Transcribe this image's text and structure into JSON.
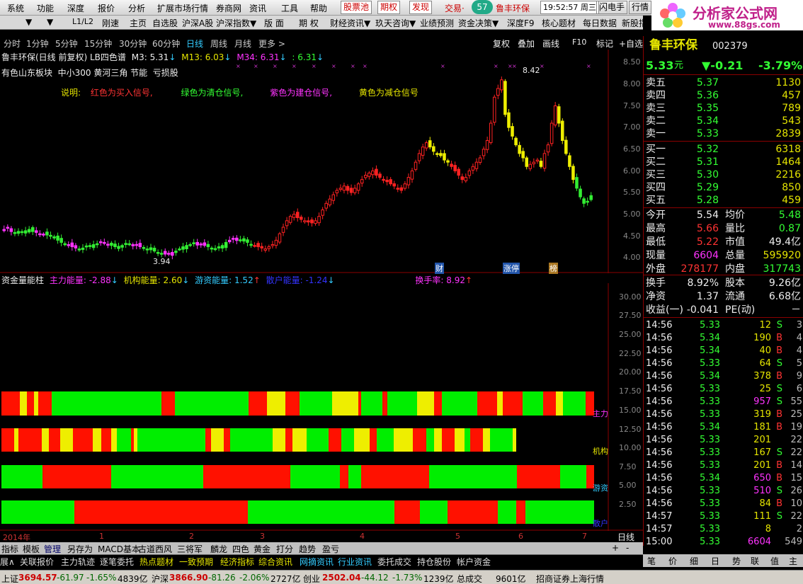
{
  "menu": [
    "系统",
    "功能",
    "深度",
    "报价",
    "分析",
    "扩展市场行情",
    "券商网",
    "资讯",
    "工具",
    "帮助",
    "股票池",
    "期权",
    "发现",
    "交易·",
    "57",
    "鲁丰环保"
  ],
  "clock": "19:52:57 周三",
  "menu_right": [
    "闪电手",
    "行情"
  ],
  "logo": {
    "title": "分析家公式网",
    "url": "www.88gs.com"
  },
  "toolbar": [
    "▼",
    "▼",
    "L1/L2",
    "刚速",
    "主页",
    "自选股",
    "沪深A股",
    "沪深指数▼",
    "版 面",
    "期 权",
    "财经资讯▼",
    "玖天咨询▼",
    "业绩预测",
    "资金决策▼",
    "深度F9",
    "核心题材",
    "每日数据",
    "新股指南"
  ],
  "periods": [
    "分时",
    "1分钟",
    "5分钟",
    "15分钟",
    "30分钟",
    "60分钟",
    "日线",
    "周线",
    "月线",
    "更多 >"
  ],
  "chart_tools": [
    "复权",
    "叠加",
    "画线",
    "F10",
    "标记",
    "+自选"
  ],
  "legend": {
    "title": "鲁丰环保(日线 前复权) LB四色谱",
    "m3": "M3: 5.31",
    "m13": "M13: 6.03",
    "m34": "M34: 6.31",
    "m4": ": 6.31"
  },
  "concepts": "有色山东板块  中小300 黄河三角 节能  亏损股",
  "explain": {
    "lead": "说明:",
    "red": "红色为买入信号,",
    "green": "绿色为清仓信号,",
    "purple": "紫色为建仓信号,",
    "yellow": "黄色为减仓信号"
  },
  "price_axis": [
    "8.50",
    "8.00",
    "7.50",
    "7.00",
    "6.50",
    "6.00",
    "5.50",
    "5.00",
    "4.50",
    "4.00"
  ],
  "annotations": {
    "high": "8.42",
    "low": "3.94",
    "badge1": "财",
    "badge2": "涨停",
    "badge3": "榜"
  },
  "energy": {
    "title": "资金量能柱",
    "main": "主力能量: -2.88",
    "inst": "机构能量: 2.60",
    "hot": "游资能量: 1.52",
    "retail": "散户能量: -1.24",
    "turnover": "换手率: 8.92"
  },
  "energy_axis": [
    "30.00",
    "27.50",
    "25.00",
    "22.50",
    "20.00",
    "17.50",
    "15.00",
    "12.50",
    "10.00",
    "7.50",
    "5.00",
    "2.50"
  ],
  "band_labels": [
    "主力",
    "机构",
    "游资",
    "散户"
  ],
  "time_axis": [
    "2014年",
    "1",
    "2",
    "3",
    "4",
    "5",
    "6",
    "7",
    "8"
  ],
  "daily_label": "日线",
  "quote": {
    "name": "鲁丰环保",
    "code": "002379",
    "price": "5.33",
    "unit": "元",
    "change": "▼-0.21",
    "pct": "-3.79%",
    "asks": [
      [
        "卖五",
        "5.37",
        "1130"
      ],
      [
        "卖四",
        "5.36",
        "457"
      ],
      [
        "卖三",
        "5.35",
        "789"
      ],
      [
        "卖二",
        "5.34",
        "543"
      ],
      [
        "卖一",
        "5.33",
        "2839"
      ]
    ],
    "bids": [
      [
        "买一",
        "5.32",
        "6318"
      ],
      [
        "买二",
        "5.31",
        "1464"
      ],
      [
        "买三",
        "5.30",
        "2216"
      ],
      [
        "买四",
        "5.29",
        "850"
      ],
      [
        "买五",
        "5.28",
        "459"
      ]
    ],
    "stats": [
      [
        "今开",
        "5.54",
        "均价",
        "5.48"
      ],
      [
        "最高",
        "5.66",
        "量比",
        "0.87"
      ],
      [
        "最低",
        "5.22",
        "市值",
        "49.4亿"
      ],
      [
        "现量",
        "6604",
        "总量",
        "595920"
      ],
      [
        "外盘",
        "278177",
        "内盘",
        "317743"
      ]
    ],
    "fund": [
      [
        "换手",
        "8.92%",
        "股本",
        "9.26亿"
      ],
      [
        "净资",
        "1.37",
        "流通",
        "6.68亿"
      ],
      [
        "收益(一)",
        "-0.041",
        "PE(动)",
        "－"
      ]
    ]
  },
  "ticks": [
    [
      "14:56",
      "5.33",
      "12",
      "S",
      "3"
    ],
    [
      "14:56",
      "5.34",
      "190",
      "B",
      "4"
    ],
    [
      "14:56",
      "5.34",
      "40",
      "B",
      "4"
    ],
    [
      "14:56",
      "5.33",
      "64",
      "S",
      "5"
    ],
    [
      "14:56",
      "5.34",
      "378",
      "B",
      "9"
    ],
    [
      "14:56",
      "5.33",
      "25",
      "S",
      "6"
    ],
    [
      "14:56",
      "5.33",
      "957",
      "S",
      "55"
    ],
    [
      "14:56",
      "5.33",
      "319",
      "B",
      "25"
    ],
    [
      "14:56",
      "5.34",
      "181",
      "B",
      "19"
    ],
    [
      "14:56",
      "5.33",
      "201",
      "",
      "22"
    ],
    [
      "14:56",
      "5.33",
      "167",
      "S",
      "22"
    ],
    [
      "14:56",
      "5.33",
      "201",
      "B",
      "14"
    ],
    [
      "14:56",
      "5.34",
      "650",
      "B",
      "15"
    ],
    [
      "14:56",
      "5.33",
      "510",
      "S",
      "26"
    ],
    [
      "14:56",
      "5.33",
      "84",
      "B",
      "10"
    ],
    [
      "14:57",
      "5.33",
      "111",
      "S",
      "22"
    ],
    [
      "14:57",
      "5.33",
      "8",
      "",
      "2"
    ],
    [
      "15:00",
      "5.33",
      "6604",
      "",
      "549"
    ]
  ],
  "bottom_tabs": [
    "指标",
    "模板",
    "管理",
    "另存为",
    "MACD基本",
    "古道西风",
    "三将军",
    "麟龙",
    "四色",
    "黄金",
    "打分",
    "趋势",
    "盈亏"
  ],
  "bottom_right": [
    "+",
    "-"
  ],
  "info_tabs": [
    "展∧",
    "关联报价",
    "主力轨迹",
    "逐笔委托",
    "热点题材",
    "一致预期",
    "经济指标",
    "综合资讯",
    "网摘资讯",
    "行业资讯",
    "委托成交",
    "持仓股份",
    "帐户资金"
  ],
  "right_tabs": [
    "侧边栏<",
    "笔",
    "价",
    "细",
    "日",
    "势",
    "联",
    "值",
    "主"
  ],
  "status": {
    "sh_label": "上证",
    "sh_val": "3694.57",
    "sh_chg": "-61.97",
    "sh_pct": "-1.65%",
    "sh_amt": "4839亿",
    "sz_label": "沪深",
    "sz_val": "3866.90",
    "sz_chg": "-81.26",
    "sz_pct": "-2.06%",
    "sz_amt": "2727亿",
    "cy_label": "创业",
    "cy_val": "2502.04",
    "cy_chg": "-44.12",
    "cy_pct": "-1.73%",
    "cy_amt": "1239亿",
    "total_label": "总成交",
    "total_val": "9601亿",
    "broker": "招商证券上海行情"
  },
  "chart_data": {
    "type": "candlestick",
    "y_range": [
      3.8,
      8.6
    ],
    "closes": [
      4.55,
      4.58,
      4.5,
      4.48,
      4.46,
      4.5,
      4.52,
      4.55,
      4.5,
      4.48,
      4.45,
      4.44,
      4.42,
      4.4,
      4.38,
      4.3,
      4.25,
      4.22,
      4.2,
      4.15,
      4.12,
      4.1,
      4.12,
      4.15,
      4.18,
      4.2,
      4.22,
      4.25,
      4.25,
      4.2,
      4.18,
      4.15,
      4.16,
      4.18,
      4.2,
      4.22,
      4.2,
      4.18,
      4.15,
      4.12,
      4.1,
      4.08,
      4.05,
      4.02,
      4.0,
      3.98,
      4.0,
      4.02,
      4.05,
      4.1,
      4.15,
      4.18,
      4.2,
      4.22,
      4.25,
      4.2,
      4.18,
      4.15,
      4.12,
      4.1,
      4.12,
      4.18,
      4.25,
      4.3,
      4.32,
      4.35,
      4.3,
      4.28,
      4.25,
      4.2,
      4.18,
      4.15,
      4.12,
      4.1,
      4.15,
      4.2,
      4.3,
      4.45,
      4.6,
      4.75,
      4.85,
      4.9,
      4.82,
      4.78,
      4.75,
      4.72,
      4.7,
      4.75,
      4.85,
      5.0,
      5.15,
      5.25,
      5.35,
      5.45,
      5.5,
      5.55,
      5.45,
      5.4,
      5.5,
      5.6,
      5.7,
      5.8,
      5.85,
      5.9,
      5.8,
      5.75,
      5.7,
      5.65,
      5.6,
      5.55,
      5.5,
      5.45,
      5.6,
      5.75,
      5.9,
      6.1,
      6.3,
      6.45,
      6.55,
      6.45,
      6.35,
      6.3,
      6.25,
      6.15,
      6.1,
      6.0,
      5.9,
      5.8,
      5.7,
      5.75,
      5.9,
      6.0,
      6.1,
      6.2,
      6.4,
      6.6,
      7.0,
      7.6,
      7.8,
      8.0,
      7.2,
      6.9,
      6.7,
      6.5,
      6.3,
      6.2,
      6.0,
      6.05,
      6.1,
      6.15,
      6.0,
      6.3,
      6.5,
      7.0,
      7.4,
      7.0,
      6.6,
      6.3,
      6.0,
      5.7,
      5.5,
      5.3,
      5.15,
      5.2,
      5.33
    ]
  }
}
